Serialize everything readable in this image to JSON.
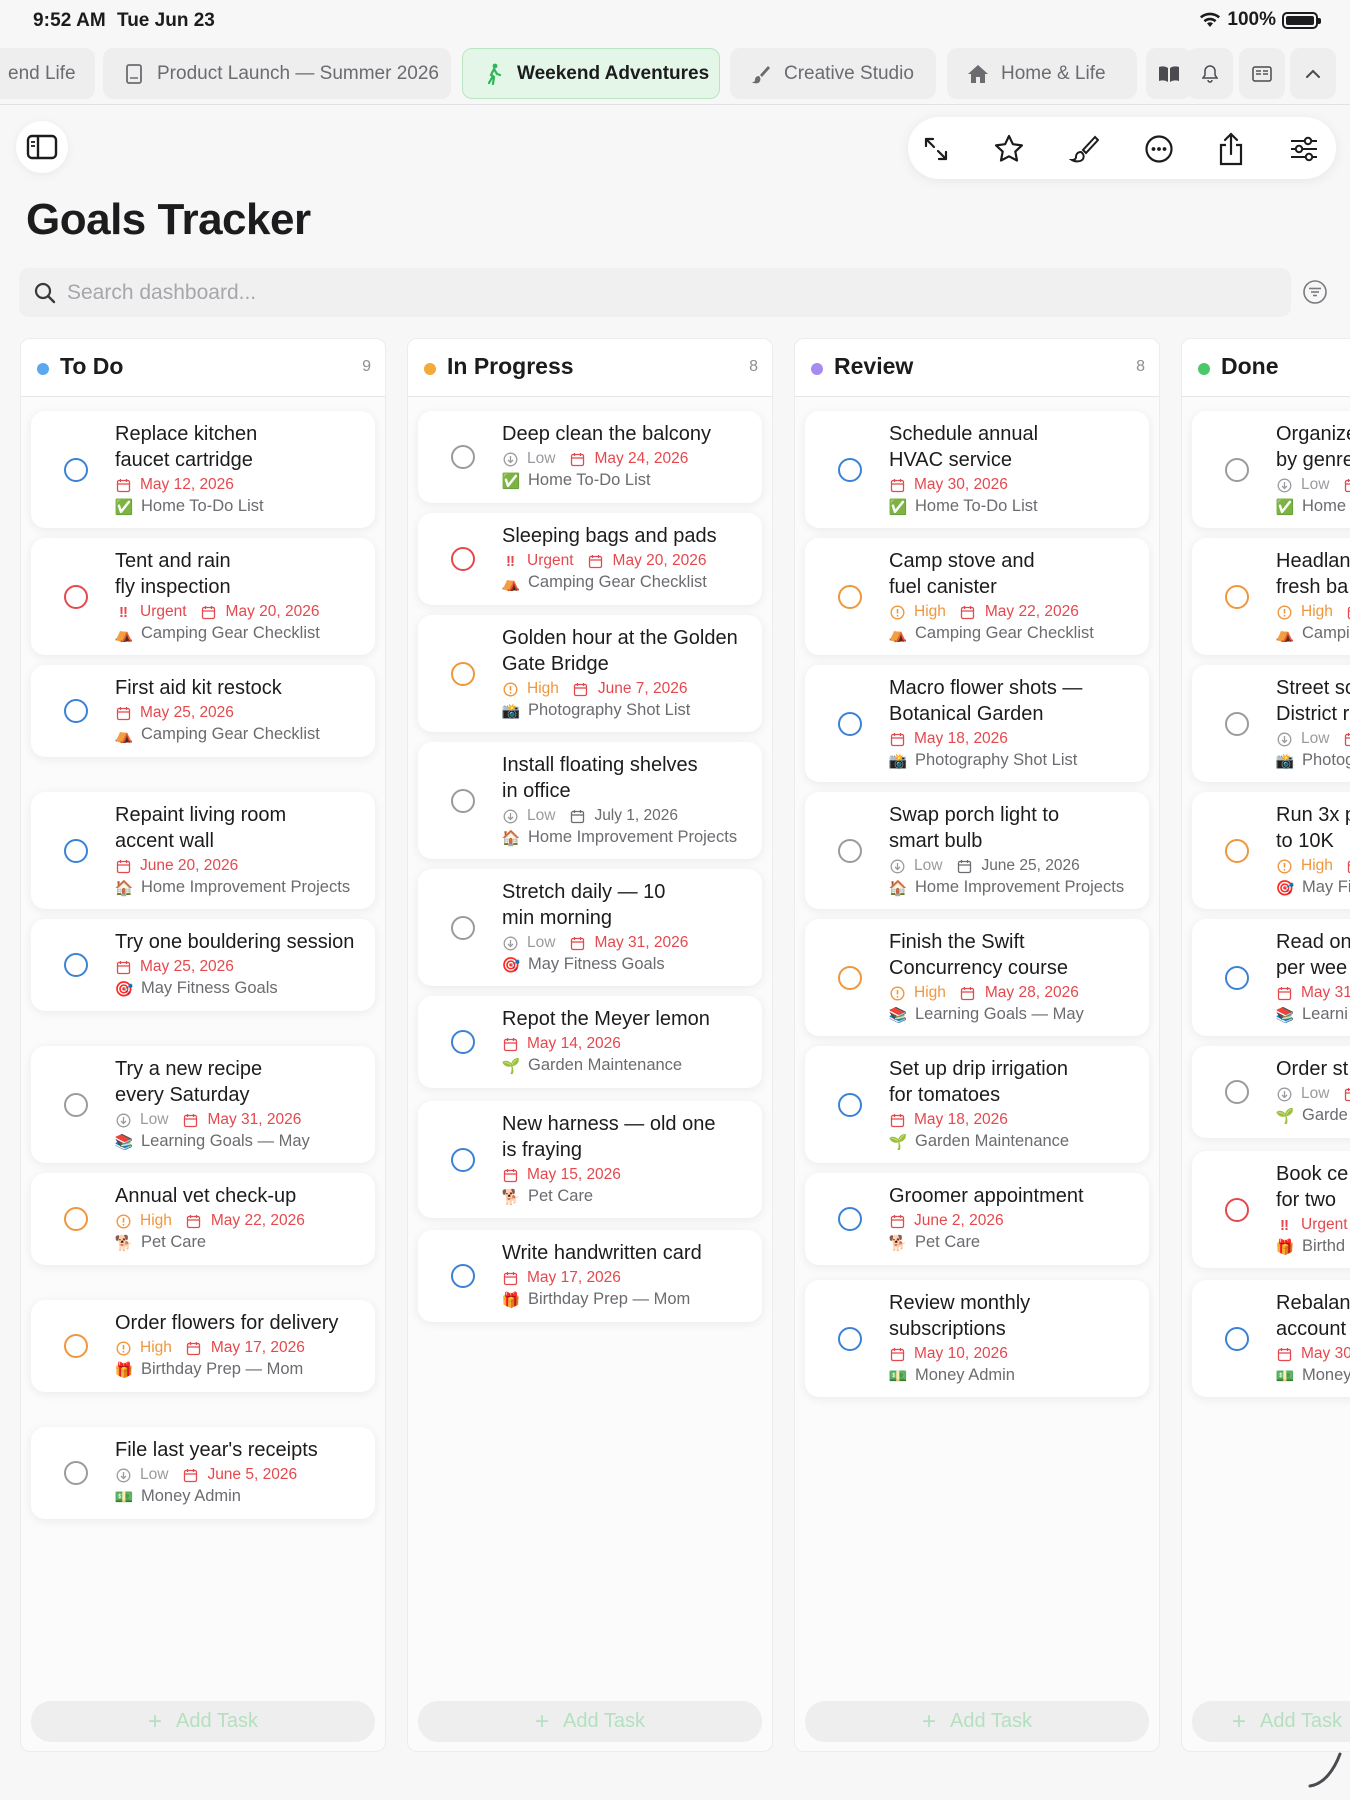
{
  "status": {
    "time": "9:52 AM",
    "date": "Tue Jun 23",
    "battery": "100%"
  },
  "tabs": [
    {
      "label": "end Life",
      "icon": "",
      "active": false
    },
    {
      "label": "Product Launch — Summer 2026",
      "icon": "document-icon",
      "active": false
    },
    {
      "label": "Weekend Adventures",
      "icon": "hiker-icon",
      "active": true
    },
    {
      "label": "Creative Studio",
      "icon": "paintbrush-icon",
      "active": false
    },
    {
      "label": "Home & Life",
      "icon": "house-icon",
      "active": false
    }
  ],
  "tab_buttons": [
    "book-icon",
    "bell-icon",
    "reader-icon",
    "chevron-up-icon"
  ],
  "toolbar": [
    "expand-icon",
    "star-icon",
    "paintbrush-icon",
    "more-icon",
    "share-icon",
    "sliders-icon"
  ],
  "page": {
    "title": "Goals Tracker"
  },
  "search": {
    "placeholder": "Search dashboard..."
  },
  "add_task_label": "Add Task",
  "columns": [
    {
      "title": "To Do",
      "count": "9",
      "dot_color": "#5aa9f0",
      "cards": [
        {
          "title": [
            "Replace kitchen",
            "faucet cartridge"
          ],
          "priority": "",
          "priority_icon": "",
          "date": "May 12, 2026",
          "date_red": true,
          "list": "Home To-Do List",
          "list_emoji": "✅",
          "ring": "#3b82d6"
        },
        {
          "title": [
            "Tent and rain",
            "fly inspection"
          ],
          "priority": "Urgent",
          "priority_icon": "!!",
          "date": "May 20, 2026",
          "date_red": true,
          "list": "Camping Gear Checklist",
          "list_emoji": "⛺",
          "ring": "#e5484d"
        },
        {
          "title": [
            "First aid kit restock"
          ],
          "priority": "",
          "priority_icon": "",
          "date": "May 25, 2026",
          "date_red": true,
          "list": "Camping Gear Checklist",
          "list_emoji": "⛺",
          "ring": "#3b82d6"
        },
        {
          "title": [
            "Repaint living room",
            "accent wall"
          ],
          "priority": "",
          "priority_icon": "",
          "date": "June 20, 2026",
          "date_red": true,
          "list": "Home Improvement Projects",
          "list_emoji": "🏠",
          "ring": "#3b82d6"
        },
        {
          "title": [
            "Try one bouldering session"
          ],
          "priority": "",
          "priority_icon": "",
          "date": "May 25, 2026",
          "date_red": true,
          "list": "May Fitness Goals",
          "list_emoji": "🎯",
          "ring": "#3b82d6"
        },
        {
          "title": [
            "Try a new recipe",
            "every Saturday"
          ],
          "priority": "Low",
          "priority_icon": "low",
          "date": "May 31, 2026",
          "date_red": true,
          "list": "Learning Goals — May",
          "list_emoji": "📚",
          "ring": "#9a9a9f"
        },
        {
          "title": [
            "Annual vet check-up"
          ],
          "priority": "High",
          "priority_icon": "high",
          "date": "May 22, 2026",
          "date_red": true,
          "list": "Pet Care",
          "list_emoji": "🐕",
          "ring": "#f0963c"
        },
        {
          "title": [
            "Order flowers for delivery"
          ],
          "priority": "High",
          "priority_icon": "high",
          "date": "May 17, 2026",
          "date_red": true,
          "list": "Birthday Prep — Mom",
          "list_emoji": "🎁",
          "ring": "#f0963c"
        },
        {
          "title": [
            "File last year's receipts"
          ],
          "priority": "Low",
          "priority_icon": "low",
          "date": "June 5, 2026",
          "date_red": true,
          "list": "Money Admin",
          "list_emoji": "💵",
          "ring": "#9a9a9f"
        }
      ]
    },
    {
      "title": "In Progress",
      "count": "8",
      "dot_color": "#f4a93b",
      "cards": [
        {
          "title": [
            "Deep clean the balcony"
          ],
          "priority": "Low",
          "priority_icon": "low",
          "date": "May 24, 2026",
          "date_red": true,
          "list": "Home To-Do List",
          "list_emoji": "✅",
          "ring": "#9a9a9f"
        },
        {
          "title": [
            "Sleeping bags and pads"
          ],
          "priority": "Urgent",
          "priority_icon": "!!",
          "date": "May 20, 2026",
          "date_red": true,
          "list": "Camping Gear Checklist",
          "list_emoji": "⛺",
          "ring": "#e5484d"
        },
        {
          "title": [
            "Golden hour at the Golden",
            "Gate Bridge"
          ],
          "priority": "High",
          "priority_icon": "high",
          "date": "June 7, 2026",
          "date_red": true,
          "list": "Photography Shot List",
          "list_emoji": "📸",
          "ring": "#f0963c"
        },
        {
          "title": [
            "Install floating shelves",
            "in office"
          ],
          "priority": "Low",
          "priority_icon": "low",
          "date": "July 1, 2026",
          "date_red": false,
          "list": "Home Improvement Projects",
          "list_emoji": "🏠",
          "ring": "#9a9a9f"
        },
        {
          "title": [
            "Stretch daily — 10",
            "min morning"
          ],
          "priority": "Low",
          "priority_icon": "low",
          "date": "May 31, 2026",
          "date_red": true,
          "list": "May Fitness Goals",
          "list_emoji": "🎯",
          "ring": "#9a9a9f"
        },
        {
          "title": [
            "Repot the Meyer lemon"
          ],
          "priority": "",
          "priority_icon": "",
          "date": "May 14, 2026",
          "date_red": true,
          "list": "Garden Maintenance",
          "list_emoji": "🌱",
          "ring": "#3b82d6"
        },
        {
          "title": [
            "New harness — old one",
            "is fraying"
          ],
          "priority": "",
          "priority_icon": "",
          "date": "May 15, 2026",
          "date_red": true,
          "list": "Pet Care",
          "list_emoji": "🐕",
          "ring": "#3b82d6"
        },
        {
          "title": [
            "Write handwritten card"
          ],
          "priority": "",
          "priority_icon": "",
          "date": "May 17, 2026",
          "date_red": true,
          "list": "Birthday Prep — Mom",
          "list_emoji": "🎁",
          "ring": "#3b82d6"
        }
      ]
    },
    {
      "title": "Review",
      "count": "8",
      "dot_color": "#a78bf0",
      "cards": [
        {
          "title": [
            "Schedule annual",
            "HVAC service"
          ],
          "priority": "",
          "priority_icon": "",
          "date": "May 30, 2026",
          "date_red": true,
          "list": "Home To-Do List",
          "list_emoji": "✅",
          "ring": "#3b82d6"
        },
        {
          "title": [
            "Camp stove and",
            "fuel canister"
          ],
          "priority": "High",
          "priority_icon": "high",
          "date": "May 22, 2026",
          "date_red": true,
          "list": "Camping Gear Checklist",
          "list_emoji": "⛺",
          "ring": "#f0963c"
        },
        {
          "title": [
            "Macro flower shots —",
            "Botanical Garden"
          ],
          "priority": "",
          "priority_icon": "",
          "date": "May 18, 2026",
          "date_red": true,
          "list": "Photography Shot List",
          "list_emoji": "📸",
          "ring": "#3b82d6"
        },
        {
          "title": [
            "Swap porch light to",
            "smart bulb"
          ],
          "priority": "Low",
          "priority_icon": "low",
          "date": "June 25, 2026",
          "date_red": false,
          "list": "Home Improvement Projects",
          "list_emoji": "🏠",
          "ring": "#9a9a9f"
        },
        {
          "title": [
            "Finish the Swift",
            "Concurrency course"
          ],
          "priority": "High",
          "priority_icon": "high",
          "date": "May 28, 2026",
          "date_red": true,
          "list": "Learning Goals — May",
          "list_emoji": "📚",
          "ring": "#f0963c"
        },
        {
          "title": [
            "Set up drip irrigation",
            "for tomatoes"
          ],
          "priority": "",
          "priority_icon": "",
          "date": "May 18, 2026",
          "date_red": true,
          "list": "Garden Maintenance",
          "list_emoji": "🌱",
          "ring": "#3b82d6"
        },
        {
          "title": [
            "Groomer appointment"
          ],
          "priority": "",
          "priority_icon": "",
          "date": "June 2, 2026",
          "date_red": true,
          "list": "Pet Care",
          "list_emoji": "🐕",
          "ring": "#3b82d6"
        },
        {
          "title": [
            "Review monthly",
            "subscriptions"
          ],
          "priority": "",
          "priority_icon": "",
          "date": "May 10, 2026",
          "date_red": true,
          "list": "Money Admin",
          "list_emoji": "💵",
          "ring": "#3b82d6"
        }
      ]
    },
    {
      "title": "Done",
      "count": "",
      "dot_color": "#4cc86a",
      "cards": [
        {
          "title": [
            "Organize",
            "by genre"
          ],
          "priority": "Low",
          "priority_icon": "low",
          "date": "",
          "date_red": true,
          "list": "Home",
          "list_emoji": "✅",
          "ring": "#9a9a9f"
        },
        {
          "title": [
            "Headlan",
            "fresh ba"
          ],
          "priority": "High",
          "priority_icon": "high",
          "date": "",
          "date_red": true,
          "list": "Campi",
          "list_emoji": "⛺",
          "ring": "#f0963c"
        },
        {
          "title": [
            "Street sc",
            "District r"
          ],
          "priority": "Low",
          "priority_icon": "low",
          "date": "",
          "date_red": true,
          "list": "Photog",
          "list_emoji": "📸",
          "ring": "#9a9a9f"
        },
        {
          "title": [
            "Run 3x p",
            "to 10K"
          ],
          "priority": "High",
          "priority_icon": "high",
          "date": "",
          "date_red": true,
          "list": "May Fi",
          "list_emoji": "🎯",
          "ring": "#f0963c"
        },
        {
          "title": [
            "Read on",
            "per wee"
          ],
          "priority": "",
          "priority_icon": "",
          "date": "May 31",
          "date_red": true,
          "list": "Learni",
          "list_emoji": "📚",
          "ring": "#3b82d6"
        },
        {
          "title": [
            "Order st"
          ],
          "priority": "Low",
          "priority_icon": "low",
          "date": "",
          "date_red": true,
          "list": "Garde",
          "list_emoji": "🌱",
          "ring": "#9a9a9f"
        },
        {
          "title": [
            "Book ce",
            "for two"
          ],
          "priority": "Urgent",
          "priority_icon": "!!",
          "date": "",
          "date_red": true,
          "list": "Birthd",
          "list_emoji": "🎁",
          "ring": "#e5484d"
        },
        {
          "title": [
            "Rebalan",
            "account"
          ],
          "priority": "",
          "priority_icon": "",
          "date": "May 30",
          "date_red": true,
          "list": "Money",
          "list_emoji": "💵",
          "ring": "#3b82d6"
        }
      ]
    }
  ]
}
